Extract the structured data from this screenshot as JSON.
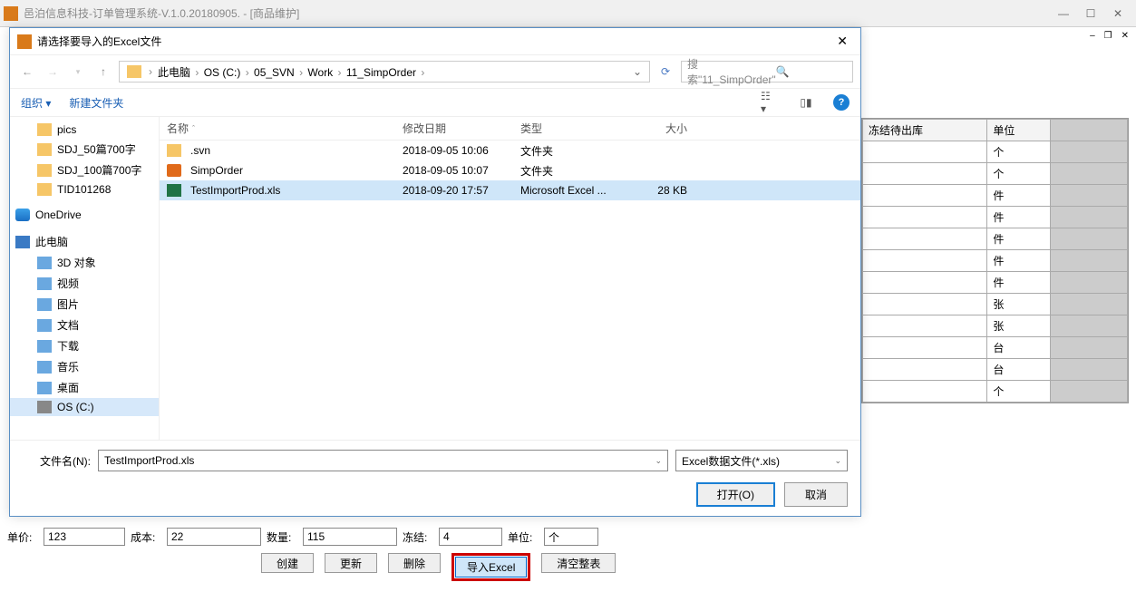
{
  "main_window": {
    "title": "邑泊信息科技-订单管理系统-V.1.0.20180905. - [商品维护]"
  },
  "bg_grid": {
    "headers": [
      "冻结待出库",
      "单位"
    ],
    "rows": [
      "个",
      "个",
      "件",
      "件",
      "件",
      "件",
      "件",
      "张",
      "张",
      "台",
      "台",
      "个"
    ]
  },
  "bottom_form": {
    "price_lbl": "单价:",
    "price_val": "123",
    "cost_lbl": "成本:",
    "cost_val": "22",
    "qty_lbl": "数量:",
    "qty_val": "115",
    "freeze_lbl": "冻结:",
    "freeze_val": "4",
    "unit_lbl": "单位:",
    "unit_val": "个",
    "btn_create": "创建",
    "btn_update": "更新",
    "btn_delete": "删除",
    "btn_import": "导入Excel",
    "btn_clear": "清空整表"
  },
  "file_dialog": {
    "title": "请选择要导入的Excel文件",
    "breadcrumb": [
      "此电脑",
      "OS (C:)",
      "05_SVN",
      "Work",
      "11_SimpOrder"
    ],
    "search_placeholder": "搜索\"11_SimpOrder\"",
    "toolbar": {
      "org": "组织 ▾",
      "newfolder": "新建文件夹"
    },
    "tree": [
      {
        "label": "pics",
        "icon": "ico-folder",
        "indent": 1
      },
      {
        "label": "SDJ_50篇700字",
        "icon": "ico-folder",
        "indent": 1
      },
      {
        "label": "SDJ_100篇700字",
        "icon": "ico-folder",
        "indent": 1
      },
      {
        "label": "TID101268",
        "icon": "ico-folder",
        "indent": 1
      },
      {
        "sep": true
      },
      {
        "label": "OneDrive",
        "icon": "ico-onedrive",
        "indent": 0,
        "group": true
      },
      {
        "sep": true
      },
      {
        "label": "此电脑",
        "icon": "ico-pc",
        "indent": 0,
        "group": true
      },
      {
        "label": "3D 对象",
        "icon": "ico-sub",
        "indent": 1
      },
      {
        "label": "视频",
        "icon": "ico-sub",
        "indent": 1
      },
      {
        "label": "图片",
        "icon": "ico-sub",
        "indent": 1
      },
      {
        "label": "文档",
        "icon": "ico-sub",
        "indent": 1
      },
      {
        "label": "下载",
        "icon": "ico-sub",
        "indent": 1
      },
      {
        "label": "音乐",
        "icon": "ico-sub",
        "indent": 1
      },
      {
        "label": "桌面",
        "icon": "ico-sub",
        "indent": 1
      },
      {
        "label": "OS (C:)",
        "icon": "ico-disk",
        "indent": 1,
        "sel": true
      }
    ],
    "columns": {
      "name": "名称",
      "date": "修改日期",
      "type": "类型",
      "size": "大小"
    },
    "rows": [
      {
        "name": ".svn",
        "date": "2018-09-05 10:06",
        "type": "文件夹",
        "size": "",
        "icon": "ico-folder-s"
      },
      {
        "name": "SimpOrder",
        "date": "2018-09-05 10:07",
        "type": "文件夹",
        "size": "",
        "icon": "ico-app"
      },
      {
        "name": "TestImportProd.xls",
        "date": "2018-09-20 17:57",
        "type": "Microsoft Excel ...",
        "size": "28 KB",
        "icon": "ico-xls",
        "selected": true
      }
    ],
    "fname_lbl": "文件名(N):",
    "fname_val": "TestImportProd.xls",
    "ftype_val": "Excel数据文件(*.xls)",
    "btn_open": "打开(O)",
    "btn_cancel": "取消"
  }
}
